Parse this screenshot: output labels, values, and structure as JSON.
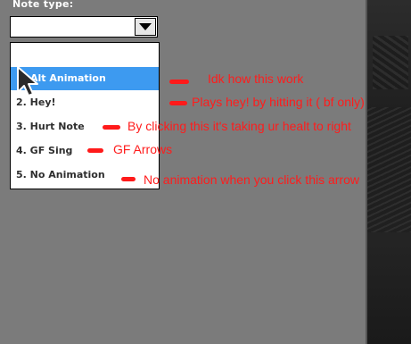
{
  "field": {
    "label": "Note type:",
    "selected_value": ""
  },
  "dropdown": {
    "options": [
      {
        "label": "",
        "selected": false
      },
      {
        "label": "Alt Animation",
        "selected": true
      },
      {
        "label": "2. Hey!",
        "selected": false
      },
      {
        "label": "3. Hurt Note",
        "selected": false
      },
      {
        "label": "4. GF Sing",
        "selected": false
      },
      {
        "label": "5. No Animation",
        "selected": false
      }
    ]
  },
  "annotations": [
    {
      "text": "Idk how this work"
    },
    {
      "text": "Plays hey! by hitting it ( bf only)"
    },
    {
      "text": "By clicking this it's taking ur healt to right"
    },
    {
      "text": "GF Arrows"
    },
    {
      "text": "No animation when you click this arrow"
    }
  ],
  "colors": {
    "background": "#7b7b7b",
    "selected_option": "#3d9af0",
    "annotation_red": "#ff1c1c"
  },
  "icons": {
    "dropdown_arrow": "triangle-down-icon",
    "cursor": "mouse-pointer-icon"
  }
}
